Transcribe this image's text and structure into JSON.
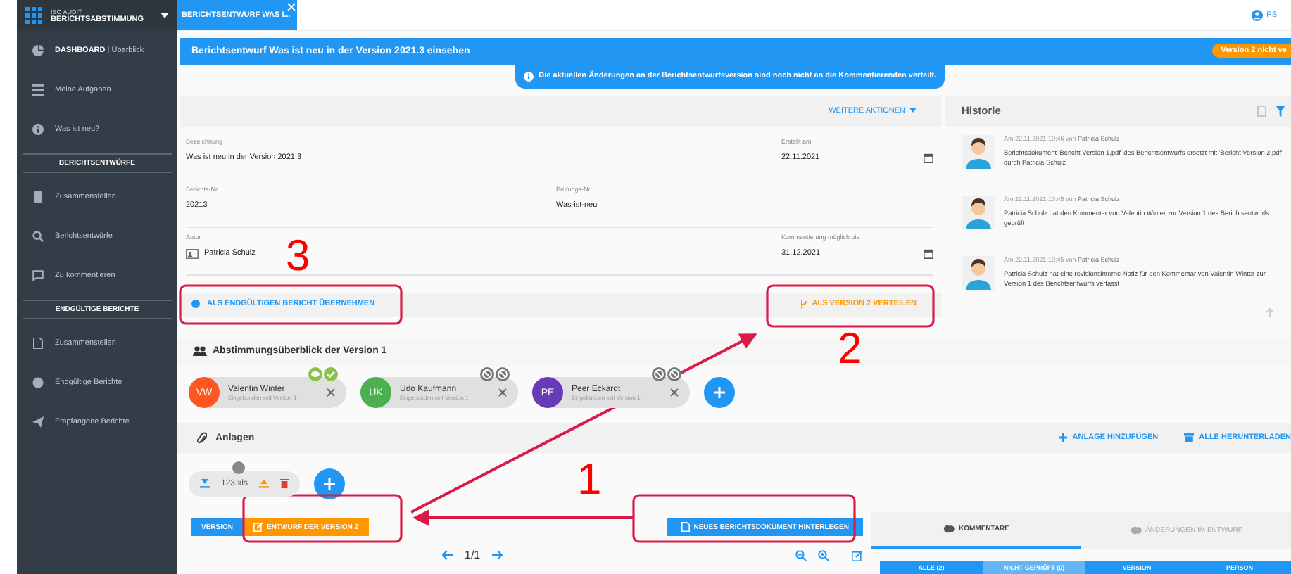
{
  "app": {
    "product": "ISO AUDIT",
    "module": "BERICHTSABSTIMMUNG"
  },
  "sidebar": {
    "items": [
      {
        "kind": "item",
        "label": "DASHBOARD",
        "detail": "| Überblick"
      },
      {
        "kind": "item",
        "label": "Meine Aufgaben"
      },
      {
        "kind": "item",
        "label": "Was ist neu?"
      },
      {
        "kind": "header",
        "label": "BERICHTSENTWÜRFE"
      },
      {
        "kind": "item",
        "label": "Zusammenstellen"
      },
      {
        "kind": "item",
        "label": "Berichtsentwürfe"
      },
      {
        "kind": "item",
        "label": "Zu kommentieren"
      },
      {
        "kind": "header",
        "label": "ENDGÜLTIGE BERICHTE"
      },
      {
        "kind": "item",
        "label": "Zusammenstellen"
      },
      {
        "kind": "item",
        "label": "Endgültige Berichte"
      },
      {
        "kind": "item",
        "label": "Empfangene Berichte"
      }
    ]
  },
  "tabs": [
    {
      "label": "BERICHTSENTWURF WAS I...",
      "selected": true
    }
  ],
  "user": {
    "initials": "PS"
  },
  "header": {
    "title": "Berichtsentwurf Was ist neu in der Version 2021.3 einsehen",
    "badge": "Version 2 nicht ve",
    "info": "Die aktuellen Änderungen an der Berichtsentwurfsversion sind noch nicht an die Kommentierenden verteilt."
  },
  "actions_menu": "WEITERE AKTIONEN",
  "form": {
    "rows": [
      {
        "left": {
          "kind": "text",
          "label": "Bezeichnung",
          "value": "Was ist neu in der Version 2021.3"
        },
        "right": {
          "kind": "date",
          "label": "Erstellt am",
          "value": "22.11.2021"
        }
      },
      {
        "left": {
          "kind": "text",
          "label": "Berichts-Nr.",
          "value": "20213"
        },
        "middle": {
          "kind": "text",
          "label": "Prüfungs-Nr.",
          "value": "Was-ist-neu"
        }
      },
      {
        "left": {
          "kind": "person",
          "label": "Autor",
          "value": "Patricia Schulz"
        },
        "right": {
          "kind": "date",
          "label": "Kommentierung möglich bis",
          "value": "31.12.2021"
        }
      }
    ]
  },
  "final_actions": {
    "accept": "ALS ENDGÜLTIGEN BERICHT ÜBERNEHMEN",
    "distribute": "ALS VERSION 2 VERTEILEN"
  },
  "history": {
    "title": "Historie",
    "entries": [
      {
        "meta": "Am 22.11.2021 10:46 von **Patricia Schulz**",
        "text": "Berichtsdokument 'Bericht Version 1.pdf' des Berichtsentwurfs ersetzt mit 'Bericht Version 2.pdf' durch Patricia Schulz"
      },
      {
        "meta": "Am 22.11.2021 10:45 von **Patricia Schulz**",
        "text": "Patricia Schulz hat den Kommentar von Valentin Winter zur Version 1 des Berichtsentwurfs geprüft"
      },
      {
        "meta": "Am 22.11.2021 10:45 von **Patricia Schulz**",
        "text": "Patricia Schulz hat eine revisionsinterne Notiz für den Kommentar von Valentin Winter zur Version 1 des Berichtsentwurfs verfasst"
      }
    ]
  },
  "voting": {
    "title": "Abstimmungsüberblick der Version 1",
    "participants": [
      {
        "initials": "VW",
        "name": "Valentin Winter",
        "sub": "Eingebunden seit Version 1",
        "color": "#ff5722",
        "commented": true,
        "approved": true
      },
      {
        "initials": "UK",
        "name": "Udo Kaufmann",
        "sub": "Eingebunden seit Version 1",
        "color": "#4caf50",
        "commented": false,
        "approved": false
      },
      {
        "initials": "PE",
        "name": "Peer Eckardt",
        "sub": "Eingebunden seit Version 1",
        "color": "#673ab7",
        "commented": false,
        "approved": false
      }
    ]
  },
  "attachments": {
    "title": "Anlagen",
    "add": "ANLAGE HINZUFÜGEN",
    "download_all": "ALLE HERUNTERLADEN",
    "files": [
      {
        "name": "123.xls"
      }
    ]
  },
  "version_tabs": [
    {
      "label": "VERSION",
      "selected": false
    },
    {
      "label": "ENTWURF DER VERSION 2",
      "selected": true
    }
  ],
  "upload_button": "NEUES BERICHTSDOKUMENT HINTERLEGEN",
  "pager": "1/1",
  "comment_tabs": [
    {
      "label": "KOMMENTARE",
      "selected": true
    },
    {
      "label": "ÄNDERUNGEN IM ENTWURF",
      "selected": false
    }
  ],
  "filters": [
    {
      "label": "ALLE (2)",
      "selected": false
    },
    {
      "label": "NICHT GEPRÜFT (0)",
      "selected": true
    },
    {
      "label": "VERSION",
      "selected": false
    },
    {
      "label": "PERSON",
      "selected": false
    }
  ],
  "annotations": [
    {
      "label": "3"
    },
    {
      "label": "2"
    },
    {
      "label": "1"
    }
  ]
}
